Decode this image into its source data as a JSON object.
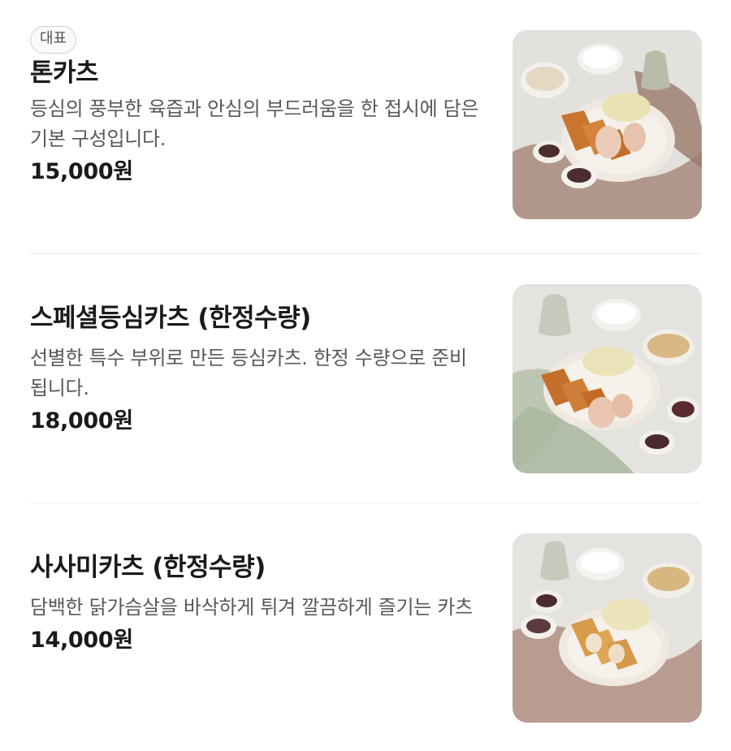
{
  "menu": {
    "items": [
      {
        "badge": "대표",
        "name": "톤카츠",
        "description": "등심의 풍부한 육즙과 안심의 부드러움을 한 접시에 담은 기본 구성입니다.",
        "price": "15,000원",
        "image_icon": "tonkatsu-photo"
      },
      {
        "name": "스페셜등심카츠 (한정수량)",
        "description": "선별한 특수 부위로 만든 등심카츠. 한정 수량으로 준비됩니다.",
        "price": "18,000원",
        "image_icon": "special-loin-katsu-photo"
      },
      {
        "name": "사사미카츠 (한정수량)",
        "description": "담백한 닭가슴살을 바삭하게 튀겨 깔끔하게 즐기는 카츠",
        "price": "14,000원",
        "image_icon": "sasami-katsu-photo"
      }
    ]
  },
  "colors": {
    "text_primary": "#1a1a1a",
    "text_secondary": "#595959",
    "divider": "#ececec",
    "badge_border": "#cfcfcf"
  }
}
